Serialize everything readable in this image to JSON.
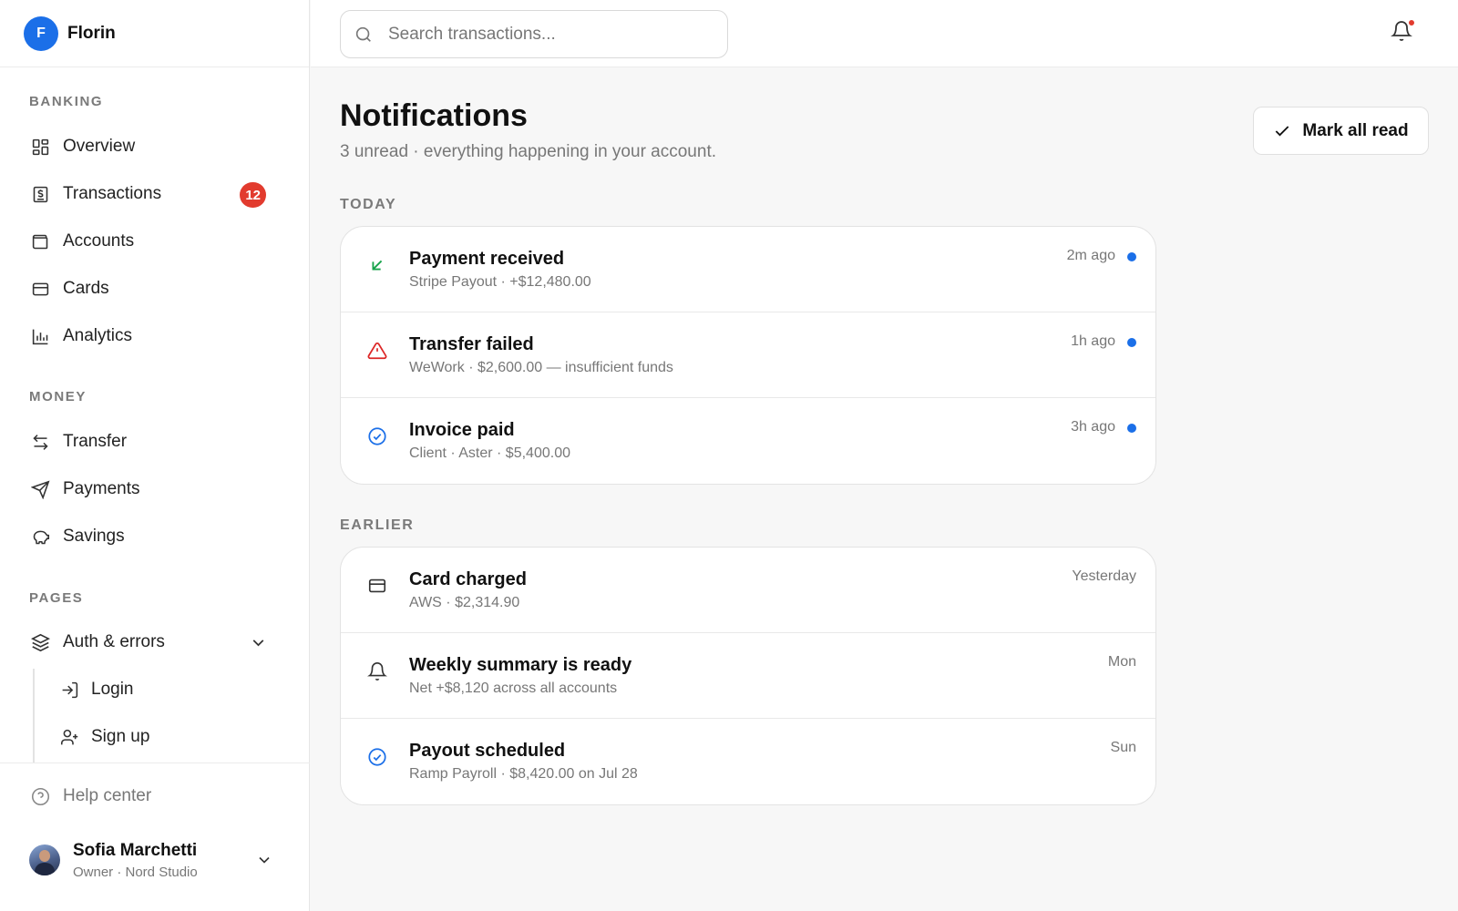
{
  "brand": {
    "logo_letter": "F",
    "name": "Florin",
    "color": "#1b6fe8"
  },
  "sidebar": {
    "sections": [
      {
        "label": "BANKING"
      },
      {
        "label": "MONEY"
      },
      {
        "label": "PAGES"
      }
    ],
    "banking": [
      {
        "label": "Overview",
        "icon": "grid-icon"
      },
      {
        "label": "Transactions",
        "icon": "receipt-icon",
        "badge": "12"
      },
      {
        "label": "Accounts",
        "icon": "wallet-icon"
      },
      {
        "label": "Cards",
        "icon": "credit-card-icon"
      },
      {
        "label": "Analytics",
        "icon": "bar-chart-icon"
      }
    ],
    "money": [
      {
        "label": "Transfer",
        "icon": "arrows-left-right-icon"
      },
      {
        "label": "Payments",
        "icon": "send-icon"
      },
      {
        "label": "Savings",
        "icon": "piggy-bank-icon"
      }
    ],
    "pages": {
      "group_label": "Auth & errors",
      "group_icon": "layers-icon",
      "children": [
        {
          "label": "Login",
          "icon": "log-in-icon"
        },
        {
          "label": "Sign up",
          "icon": "user-plus-icon"
        }
      ]
    },
    "help": {
      "label": "Help center",
      "icon": "help-circle-icon"
    },
    "user": {
      "name": "Sofia Marchetti",
      "role": "Owner · Nord Studio"
    }
  },
  "topbar": {
    "search_placeholder": "Search transactions...",
    "bell_has_unread": true
  },
  "page": {
    "title": "Notifications",
    "subtitle": "3 unread · everything happening in your account.",
    "mark_all_read": "Mark all read"
  },
  "groups": [
    {
      "label": "TODAY",
      "items": [
        {
          "title": "Payment received",
          "desc": "Stripe Payout · +$12,480.00",
          "time": "2m ago",
          "unread": true,
          "icon": "arrow-down-left-icon",
          "icon_color": "#16a34a"
        },
        {
          "title": "Transfer failed",
          "desc": "WeWork · $2,600.00 — insufficient funds",
          "time": "1h ago",
          "unread": true,
          "icon": "alert-triangle-icon",
          "icon_color": "#dc2626"
        },
        {
          "title": "Invoice paid",
          "desc": "Client · Aster · $5,400.00",
          "time": "3h ago",
          "unread": true,
          "icon": "check-circle-icon",
          "icon_color": "#1b6fe8"
        }
      ]
    },
    {
      "label": "EARLIER",
      "items": [
        {
          "title": "Card charged",
          "desc": "AWS · $2,314.90",
          "time": "Yesterday",
          "unread": false,
          "icon": "credit-card-icon",
          "icon_color": "#333333"
        },
        {
          "title": "Weekly summary is ready",
          "desc": "Net +$8,120 across all accounts",
          "time": "Mon",
          "unread": false,
          "icon": "bell-icon",
          "icon_color": "#333333"
        },
        {
          "title": "Payout scheduled",
          "desc": "Ramp Payroll · $8,420.00 on Jul 28",
          "time": "Sun",
          "unread": false,
          "icon": "check-circle-icon",
          "icon_color": "#1b6fe8"
        }
      ]
    }
  ],
  "colors": {
    "unread_dot": "#1b6fe8",
    "badge": "#e23b2e"
  }
}
